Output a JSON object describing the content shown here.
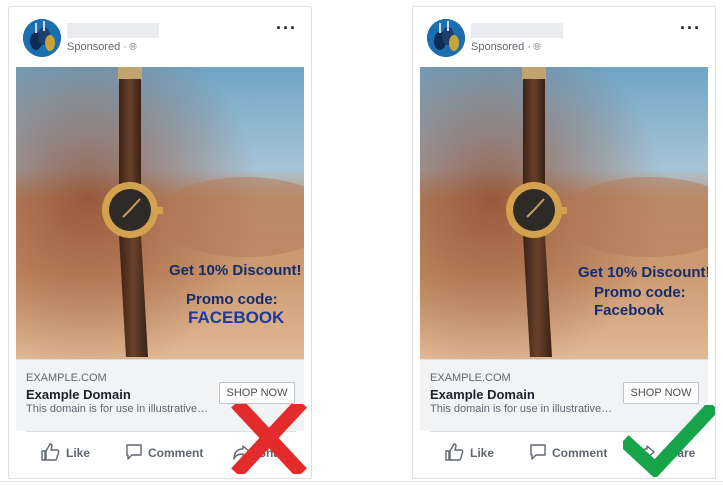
{
  "colors": {
    "fail": "#e32b2b",
    "pass": "#17a34a",
    "overlay_text": "#152c6b",
    "overlay_code_caps": "#1d3b9c"
  },
  "cards": [
    {
      "id": "left",
      "sponsored": "Sponsored ·",
      "overlay": {
        "line1": "Get 10% Discount!",
        "line2": "Promo code:",
        "line3": "FACEBOOK"
      },
      "link": {
        "domain": "EXAMPLE.COM",
        "title": "Example Domain",
        "description": "This domain is for use in illustrative…",
        "cta": "SHOP NOW"
      },
      "actions": {
        "like": "Like",
        "comment": "Comment",
        "share": "Share"
      },
      "verdict_icon": "red-x-icon"
    },
    {
      "id": "right",
      "sponsored": "Sponsored ·",
      "overlay": {
        "line1": "Get 10% Discount!",
        "line2": "Promo code:",
        "line3": "Facebook"
      },
      "link": {
        "domain": "EXAMPLE.COM",
        "title": "Example Domain",
        "description": "This domain is for use in illustrative…",
        "cta": "SHOP NOW"
      },
      "actions": {
        "like": "Like",
        "comment": "Comment",
        "share": "Share"
      },
      "verdict_icon": "green-check-icon"
    }
  ]
}
